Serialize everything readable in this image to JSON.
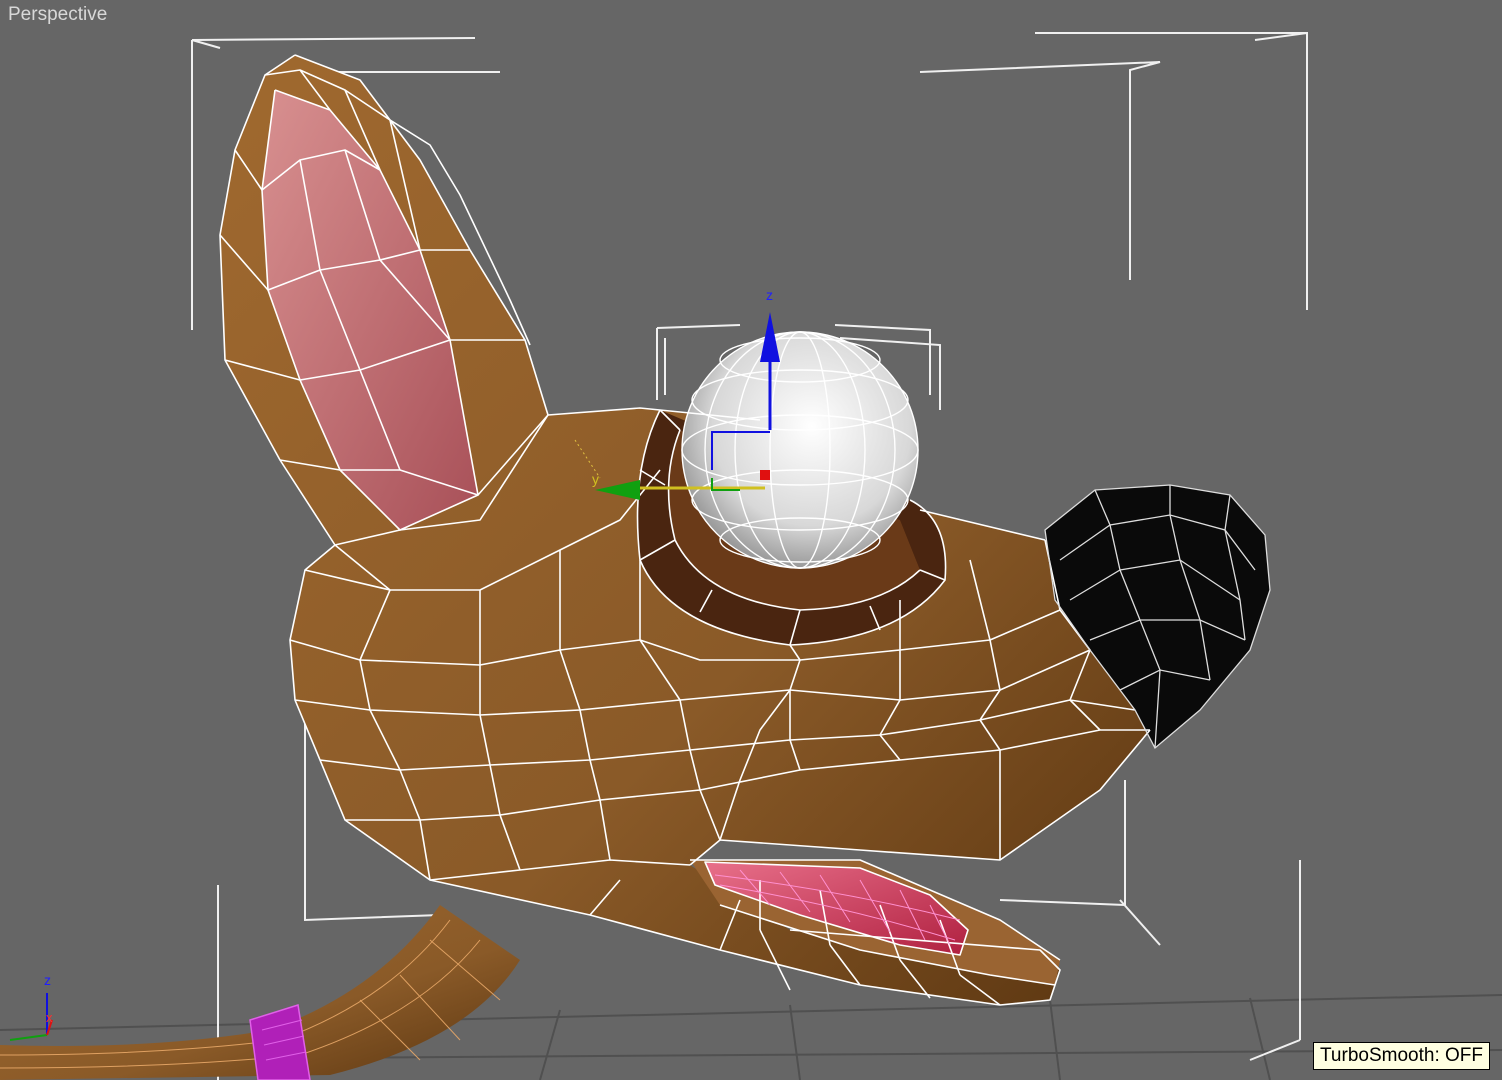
{
  "viewport": {
    "label": "Perspective",
    "status_text": "TurboSmooth: OFF"
  },
  "gizmo": {
    "z_label": "z",
    "y_label": "y"
  },
  "axis_tripod": {
    "z_label": "z",
    "x_label": "x"
  },
  "colors": {
    "background": "#666666",
    "skin": "#8a5a28",
    "ear_inner": "#c9787a",
    "eye_socket": "#4a2510",
    "eyeball": "#e6e6e6",
    "nose": "#0a0a0a",
    "tongue": "#d9506a",
    "collar": "#b020b8",
    "wireframe": "#ffffff",
    "axis_z": "#1010e0",
    "axis_y": "#10a010",
    "axis_x": "#e01010"
  }
}
